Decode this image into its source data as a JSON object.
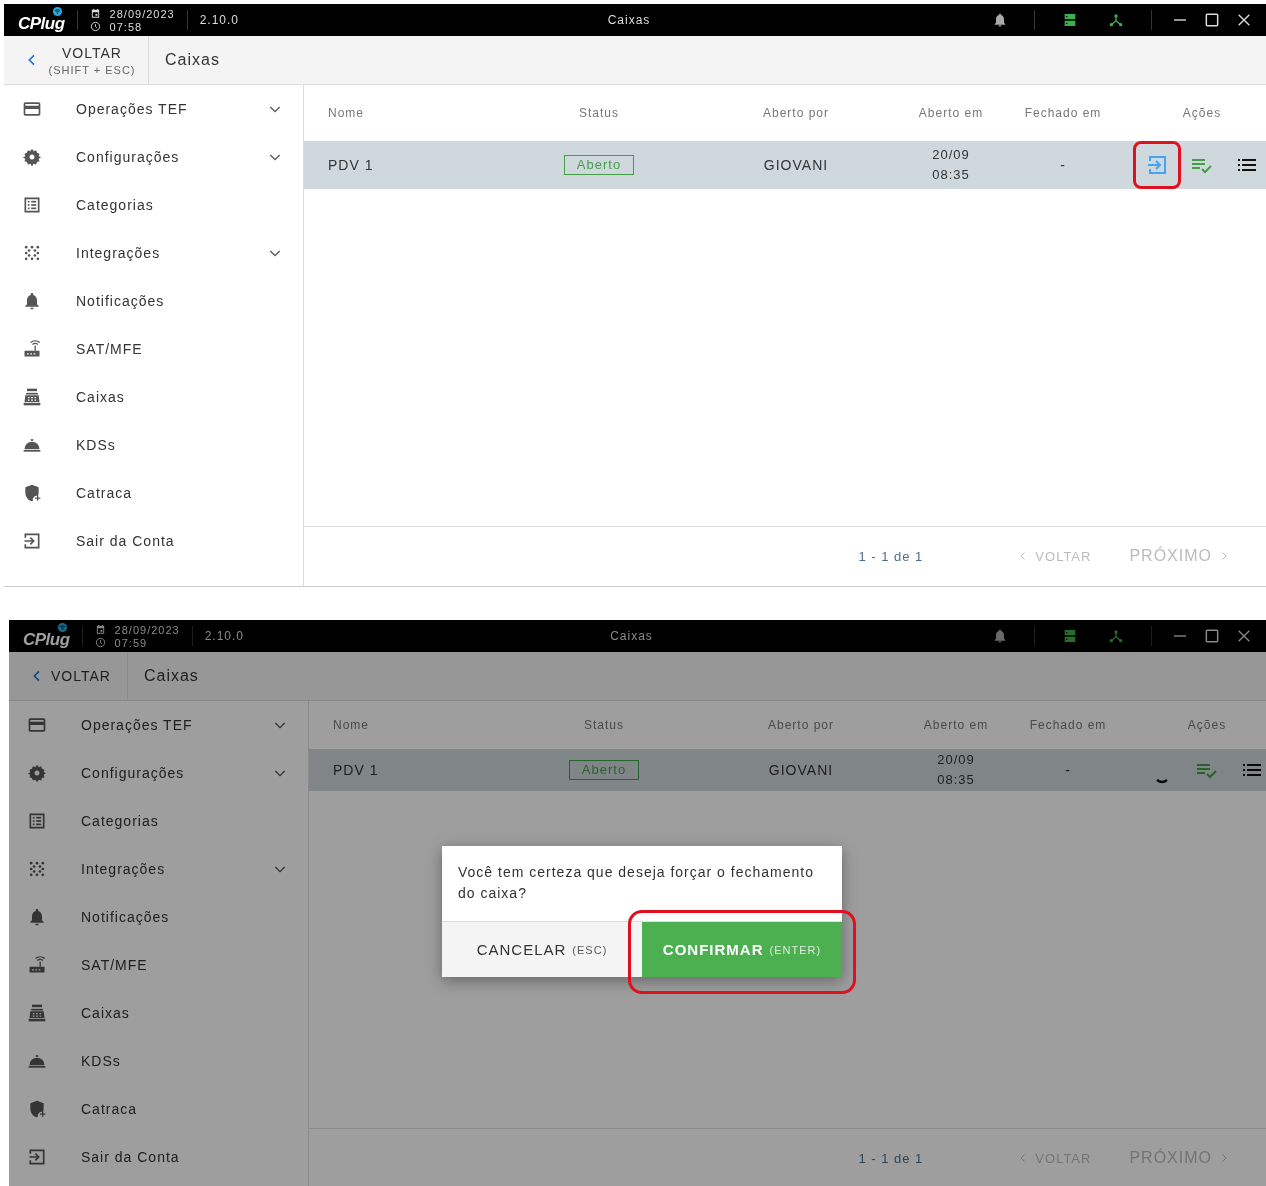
{
  "panels": [
    {
      "dimmed": false,
      "titlebar": {
        "logo": "CPlug",
        "date": "28/09/2023",
        "time": "07:58",
        "version": "2.10.0",
        "title": "Caixas"
      },
      "back": {
        "label": "VOLTAR",
        "shortcut": "(SHIFT + ESC)"
      },
      "page_title": "Caixas",
      "sidebar": {
        "items": [
          {
            "label": "Operações TEF",
            "expandable": true
          },
          {
            "label": "Configurações",
            "expandable": true
          },
          {
            "label": "Categorias",
            "expandable": false
          },
          {
            "label": "Integrações",
            "expandable": true
          },
          {
            "label": "Notificações",
            "expandable": false
          },
          {
            "label": "SAT/MFE",
            "expandable": false
          },
          {
            "label": "Caixas",
            "expandable": false
          },
          {
            "label": "KDSs",
            "expandable": false
          },
          {
            "label": "Catraca",
            "expandable": false
          },
          {
            "label": "Sair da Conta",
            "expandable": false
          }
        ]
      },
      "table": {
        "columns": [
          "Nome",
          "Status",
          "Aberto por",
          "Aberto em",
          "Fechado em",
          "Ações"
        ],
        "rows": [
          {
            "name": "PDV 1",
            "status": "Aberto",
            "opened_by": "GIOVANI",
            "opened_at": [
              "20/09",
              "08:35"
            ],
            "closed_at": "-",
            "actions": [
              {
                "kind": "exit",
                "highlighted": true
              },
              {
                "kind": "checklist",
                "highlighted": false
              },
              {
                "kind": "list",
                "highlighted": false
              }
            ]
          }
        ]
      },
      "pagination": {
        "range": "1 - 1 de 1",
        "prev": {
          "label": "VOLTAR",
          "disabled": true
        },
        "next": {
          "label": "PRÓXIMO",
          "disabled": true
        }
      }
    },
    {
      "dimmed": true,
      "titlebar": {
        "logo": "CPlug",
        "date": "28/09/2023",
        "time": "07:59",
        "version": "2.10.0",
        "title": "Caixas"
      },
      "back": {
        "label": "VOLTAR"
      },
      "page_title": "Caixas",
      "sidebar": {
        "items": [
          {
            "label": "Operações TEF",
            "expandable": true
          },
          {
            "label": "Configurações",
            "expandable": true
          },
          {
            "label": "Categorias",
            "expandable": false
          },
          {
            "label": "Integrações",
            "expandable": true
          },
          {
            "label": "Notificações",
            "expandable": false
          },
          {
            "label": "SAT/MFE",
            "expandable": false
          },
          {
            "label": "Caixas",
            "expandable": false
          },
          {
            "label": "KDSs",
            "expandable": false
          },
          {
            "label": "Catraca",
            "expandable": false
          },
          {
            "label": "Sair da Conta",
            "expandable": false
          }
        ]
      },
      "table": {
        "columns": [
          "Nome",
          "Status",
          "Aberto por",
          "Aberto em",
          "Fechado em",
          "Ações"
        ],
        "rows": [
          {
            "name": "PDV 1",
            "status": "Aberto",
            "opened_by": "GIOVANI",
            "opened_at": [
              "20/09",
              "08:35"
            ],
            "closed_at": "-",
            "actions": [
              {
                "kind": "obscured",
                "highlighted": false
              },
              {
                "kind": "checklist",
                "highlighted": false
              },
              {
                "kind": "list",
                "highlighted": false
              }
            ]
          }
        ]
      },
      "pagination": {
        "range": "1 - 1 de 1",
        "prev": {
          "label": "VOLTAR",
          "disabled": true
        },
        "next": {
          "label": "PRÓXIMO",
          "disabled": true
        }
      },
      "dialog": {
        "message": "Você tem certeza que deseja forçar o fechamento do caixa?",
        "buttons": [
          {
            "kind": "cancel",
            "label": "CANCELAR",
            "shortcut": "(ESC)",
            "highlighted": false
          },
          {
            "kind": "confirm",
            "label": "CONFIRMAR",
            "shortcut": "(ENTER)",
            "highlighted": true
          }
        ]
      }
    }
  ]
}
